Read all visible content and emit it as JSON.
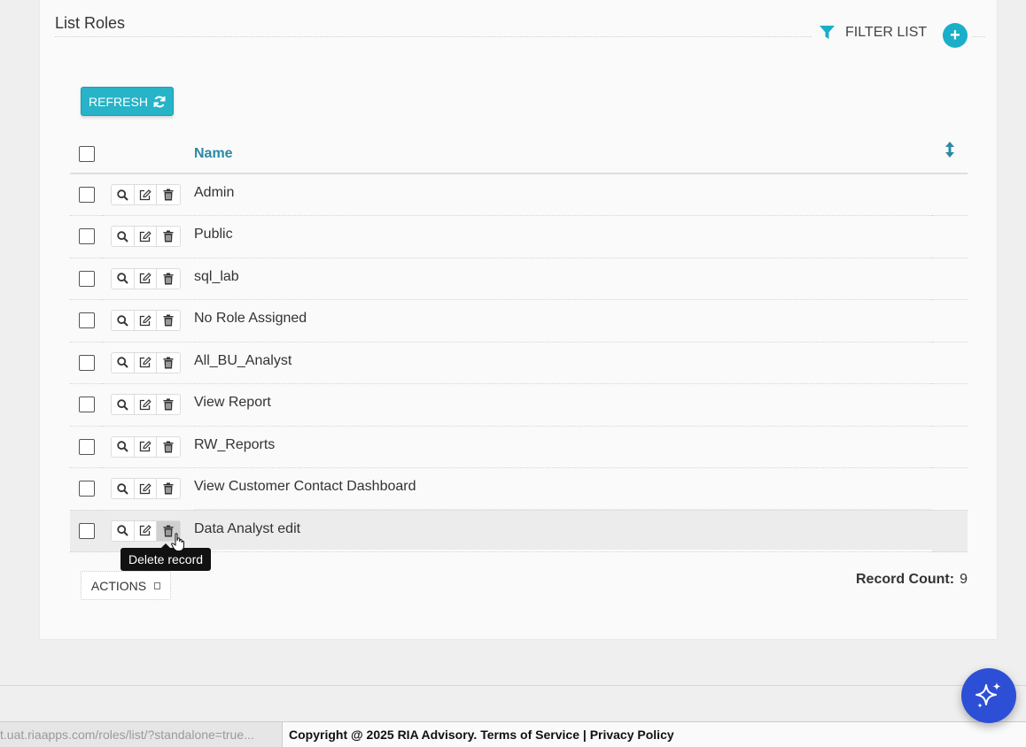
{
  "page": {
    "title": "List Roles",
    "filter_label": "FILTER LIST",
    "add_label": "+",
    "refresh_label": "REFRESH"
  },
  "table": {
    "header_name": "Name",
    "rows": [
      {
        "name": "Admin"
      },
      {
        "name": "Public"
      },
      {
        "name": "sql_lab"
      },
      {
        "name": "No Role Assigned"
      },
      {
        "name": "All_BU_Analyst"
      },
      {
        "name": "View Report"
      },
      {
        "name": "RW_Reports"
      },
      {
        "name": "View Customer Contact Dashboard"
      },
      {
        "name": "Data Analyst edit"
      }
    ]
  },
  "tooltip": "Delete record",
  "actions_label": "ACTIONS",
  "record_count": {
    "label": "Record Count:",
    "value": "9"
  },
  "status_bar": {
    "url": "t.uat.riaapps.com/roles/list/?standalone=true..."
  },
  "footer": {
    "copyright": "Copyright @ 2025 RIA Advisory.",
    "terms": "Terms of Service",
    "separator": "|",
    "privacy": "Privacy Policy"
  },
  "colors": {
    "accent": "#27b3c8",
    "header_text": "#2b8aa6",
    "ai_button": "#2c4fd6"
  },
  "icons": {
    "filter": "filter-icon",
    "add": "plus-icon",
    "refresh": "refresh-icon",
    "view": "search-icon",
    "edit": "edit-icon",
    "delete": "trash-icon",
    "sort": "sort-icon",
    "ai": "sparkles-icon"
  }
}
